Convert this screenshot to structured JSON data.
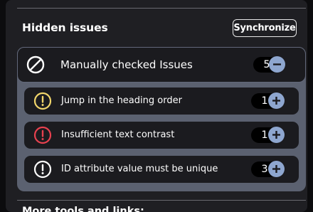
{
  "hidden_issues": {
    "title": "Hidden issues",
    "sync_label": "Synchronize",
    "group": {
      "label": "Manually checked Issues",
      "count": "5",
      "collapse_icon": "minus-icon",
      "status_icon": "ban-icon",
      "items": [
        {
          "label": "Jump in the heading order",
          "count": "1",
          "severity": "warning",
          "color": "#f2d66b",
          "icon": "exclamation-circle-icon",
          "action_icon": "plus-icon"
        },
        {
          "label": "Insufficient text contrast",
          "count": "1",
          "severity": "error",
          "color": "#e8414f",
          "icon": "exclamation-circle-icon",
          "action_icon": "plus-icon"
        },
        {
          "label": "ID attribute value must be unique",
          "count": "3",
          "severity": "info",
          "color": "#ffffff",
          "icon": "exclamation-circle-icon",
          "action_icon": "plus-icon"
        }
      ]
    }
  },
  "more_tools": {
    "title": "More tools and links:"
  },
  "colors": {
    "page_bg": "#0c0c0e",
    "panel_bg": "#1f1f23",
    "group_bg": "#5b6170",
    "row_bg": "#1b1b1f",
    "button_accent": "#8ea6cf"
  }
}
